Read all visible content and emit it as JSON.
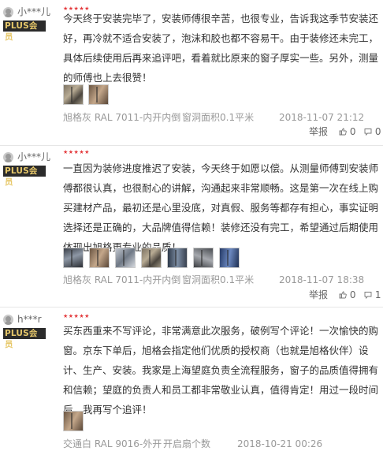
{
  "reviews": [
    {
      "username": "小***儿",
      "badge": "PLUS会员",
      "stars": "★★★★★",
      "content": "今天终于安装完毕了，安装师傅很辛苦，也很专业，告诉我这季节安装还好，再冷就不适合安装了，泡沫和胶也都不容易干。由于装修还未完工，具体后续使用后再来追评吧，看着就比原来的窗子厚实一些。另外，测量的师傅也上去很赞！",
      "thumbnail_count": 2,
      "product": "旭格灰 RAL 7011-内开内倒",
      "spec": "窗洞面积0.1平米",
      "date": "2018-11-07 21:12",
      "report": "举报",
      "likes": "0",
      "replies": "0"
    },
    {
      "username": "小***儿",
      "badge": "PLUS会员",
      "stars": "★★★★★",
      "content": "一直因为装修进度推迟了安装，今天终于如愿以偿。从测量师傅到安装师傅都很认真，也很耐心的讲解，沟通起来非常顺畅。这是第一次在线上购买建材产品，最初还是心里没底，对真假、服务等都存有担心，事实证明选择还是正确的，大品牌值得信赖！装修还没有完工，希望通过后期使用体现出旭格更专业的品质！",
      "thumbnail_count": 7,
      "product": "旭格灰 RAL 7011-内开内倒",
      "spec": "窗洞面积0.1平米",
      "date": "2018-11-07 18:38",
      "report": "举报",
      "likes": "0",
      "replies": "1"
    },
    {
      "username": "h***r",
      "badge": "PLUS会员",
      "stars": "★★★★★",
      "content": "买东西重来不写评论，非常满意此次服务，破例写个评论！一次愉快的购窗。京东下单后，旭格会指定他们优质的授权商（也就是旭格伙伴）设计、生产、安装。我家是上海望庭负责全流程服务，窗子的品质值得拥有和信赖；望庭的负责人和员工都非常敬业认真，值得肯定！用过一段时间后，我再写个追评！",
      "thumbnail_count": 1,
      "product": "交通白 RAL 9016-外开",
      "spec": "开启扇个数",
      "date": "2018-10-21 00:26"
    }
  ],
  "colors": {
    "star": "#e4393c",
    "badge_bg": "#2b2b2b",
    "badge_text": "#e7c86a",
    "meta": "#999999"
  }
}
